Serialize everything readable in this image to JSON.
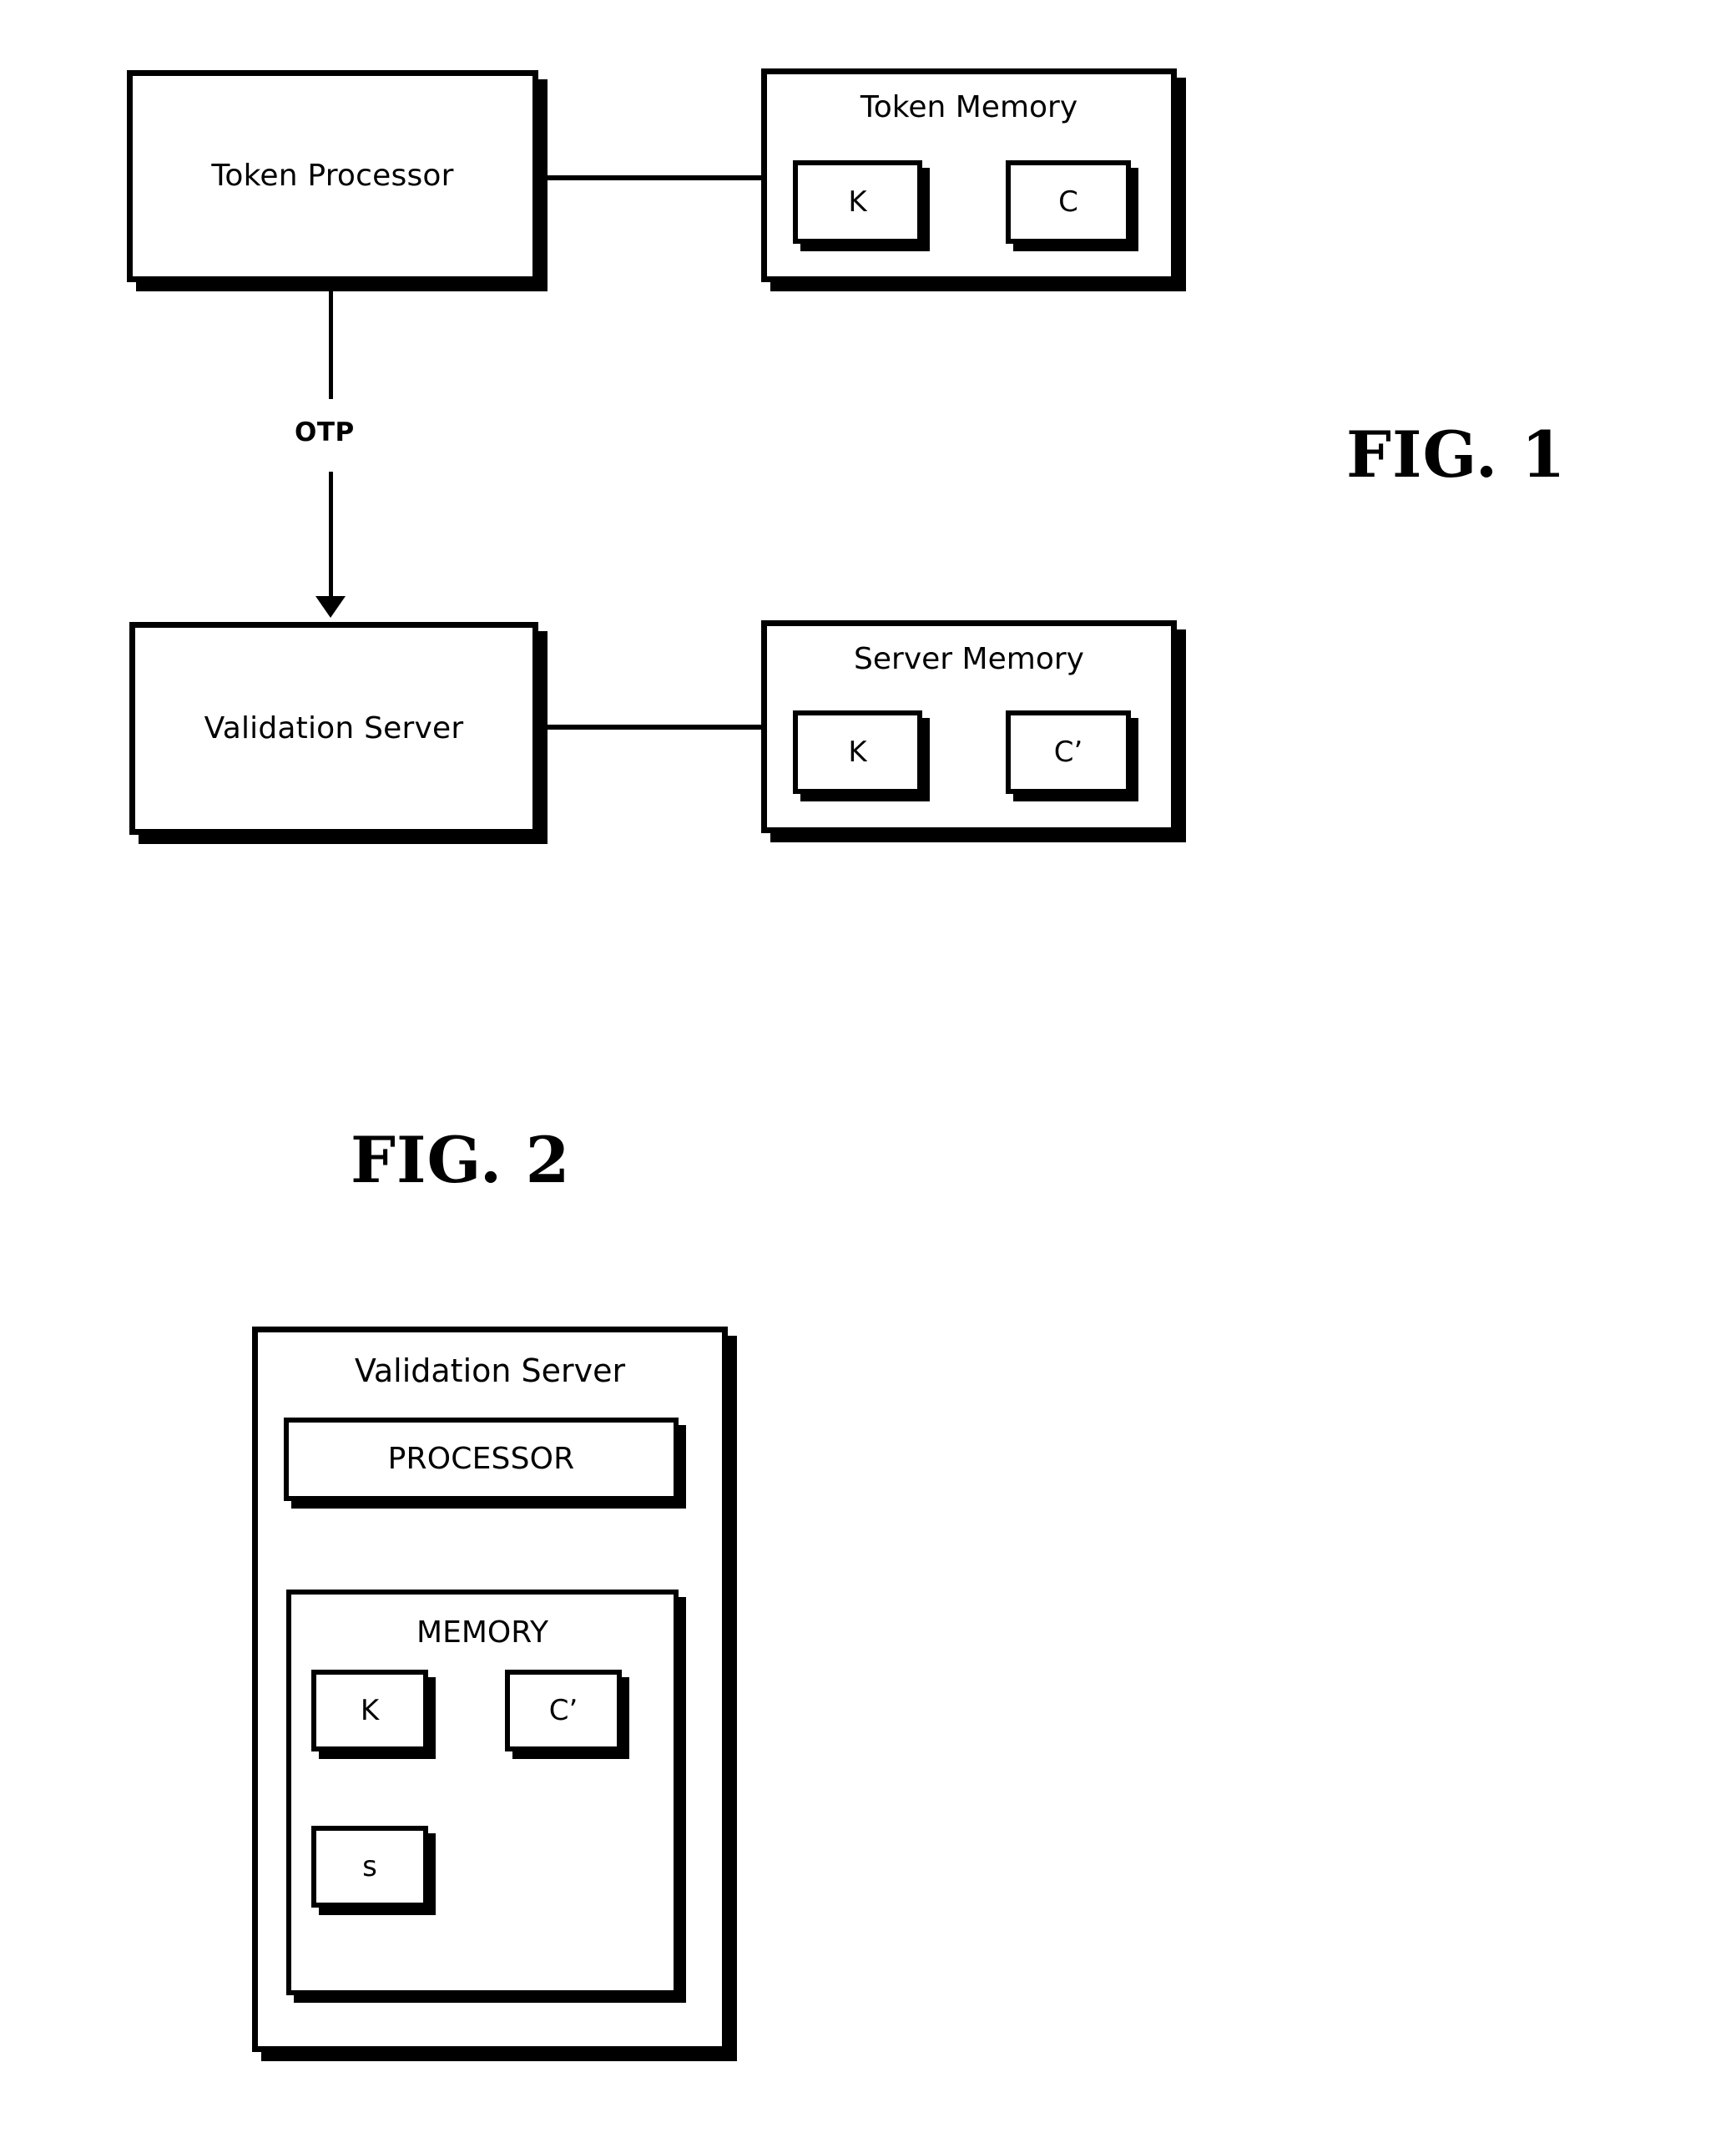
{
  "figures": [
    {
      "id": "fig1",
      "caption": "FIG. 1",
      "nodes": {
        "token_processor": {
          "label": "Token Processor"
        },
        "token_memory": {
          "label": "Token Memory",
          "slots": [
            {
              "label": "K"
            },
            {
              "label": "C"
            }
          ]
        },
        "validation_server": {
          "label": "Validation Server"
        },
        "server_memory": {
          "label": "Server Memory",
          "slots": [
            {
              "label": "K"
            },
            {
              "label": "C’"
            }
          ]
        }
      },
      "edges": [
        {
          "from": "token_processor",
          "to": "token_memory",
          "label": "",
          "style": "line"
        },
        {
          "from": "token_processor",
          "to": "validation_server",
          "label": "OTP",
          "style": "arrow"
        },
        {
          "from": "validation_server",
          "to": "server_memory",
          "label": "",
          "style": "line"
        }
      ]
    },
    {
      "id": "fig2",
      "caption": "FIG. 2",
      "nodes": {
        "validation_server": {
          "label": "Validation Server",
          "processor": {
            "label": "PROCESSOR"
          },
          "memory": {
            "label": "MEMORY",
            "slots": [
              {
                "label": "K"
              },
              {
                "label": "C’"
              },
              {
                "label": "s"
              }
            ]
          }
        }
      }
    }
  ],
  "colors": {
    "ink": "#000000",
    "paper": "#ffffff"
  }
}
